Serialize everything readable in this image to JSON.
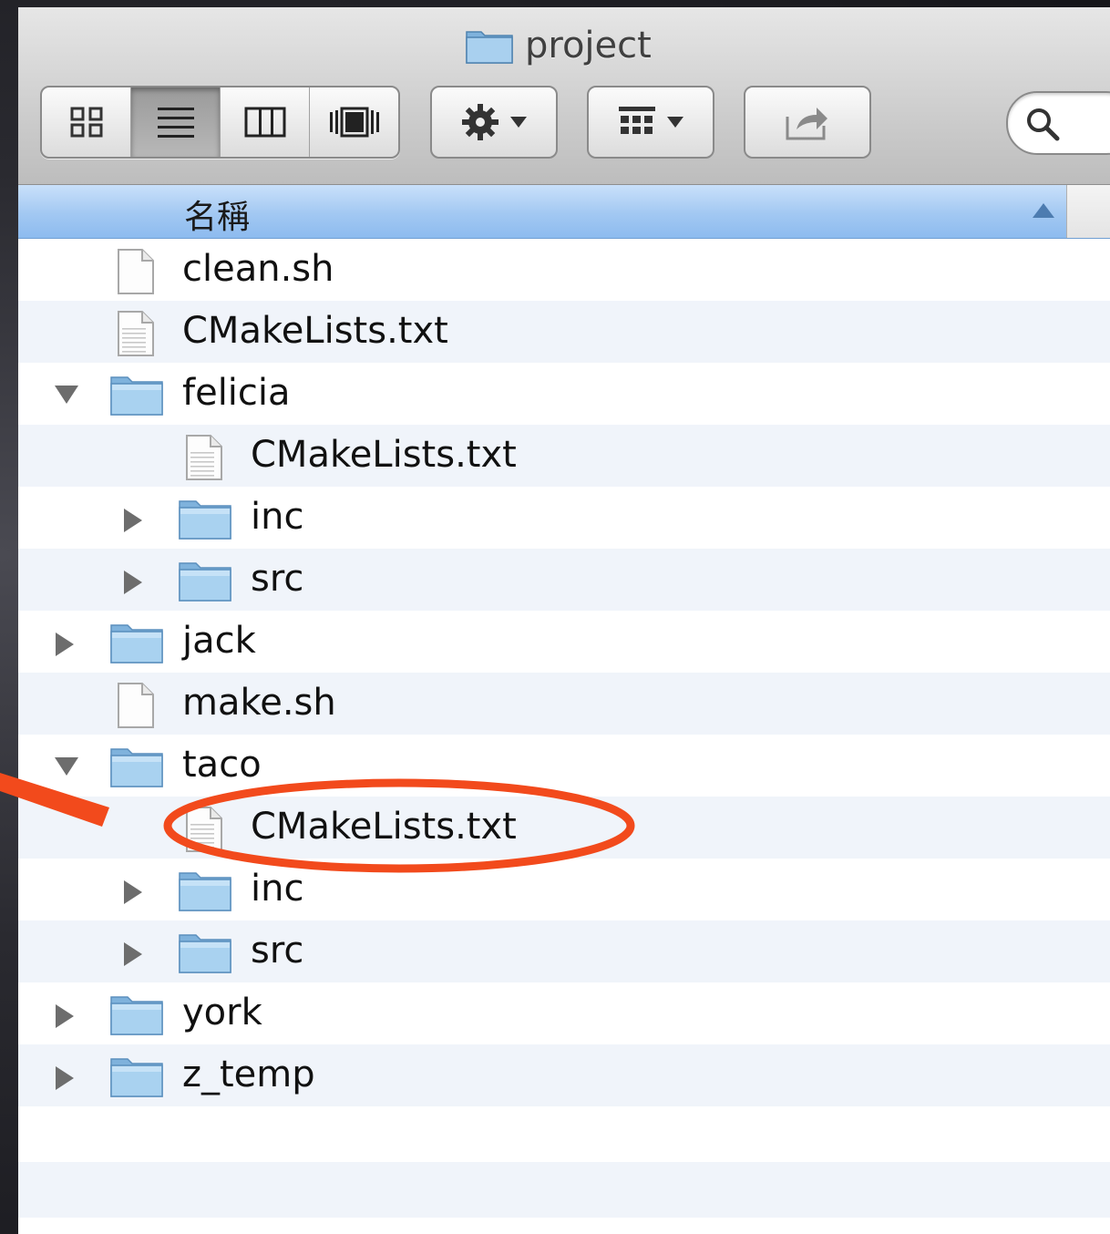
{
  "window": {
    "title": "project"
  },
  "toolbar": {
    "view_modes": [
      {
        "name": "icon-view",
        "icon": "grid-icon",
        "active": false
      },
      {
        "name": "list-view",
        "icon": "list-icon",
        "active": true
      },
      {
        "name": "column-view",
        "icon": "columns-icon",
        "active": false
      },
      {
        "name": "coverflow-view",
        "icon": "coverflow-icon",
        "active": false
      }
    ],
    "action_icon": "gear-icon",
    "arrange_icon": "arrange-icon",
    "share_icon": "share-icon",
    "search_icon": "search-icon"
  },
  "columns": {
    "name": "名稱"
  },
  "files": [
    {
      "name": "clean.sh",
      "type": "file",
      "level": 0
    },
    {
      "name": "CMakeLists.txt",
      "type": "text",
      "level": 0
    },
    {
      "name": "felicia",
      "type": "folder",
      "level": 0,
      "expanded": true
    },
    {
      "name": "CMakeLists.txt",
      "type": "text",
      "level": 1
    },
    {
      "name": "inc",
      "type": "folder",
      "level": 1,
      "expanded": false
    },
    {
      "name": "src",
      "type": "folder",
      "level": 1,
      "expanded": false
    },
    {
      "name": "jack",
      "type": "folder",
      "level": 0,
      "expanded": false
    },
    {
      "name": "make.sh",
      "type": "file",
      "level": 0
    },
    {
      "name": "taco",
      "type": "folder",
      "level": 0,
      "expanded": true
    },
    {
      "name": "CMakeLists.txt",
      "type": "text",
      "level": 1,
      "highlighted": true
    },
    {
      "name": "inc",
      "type": "folder",
      "level": 1,
      "expanded": false
    },
    {
      "name": "src",
      "type": "folder",
      "level": 1,
      "expanded": false
    },
    {
      "name": "york",
      "type": "folder",
      "level": 0,
      "expanded": false
    },
    {
      "name": "z_temp",
      "type": "folder",
      "level": 0,
      "expanded": false
    }
  ],
  "colors": {
    "header": "#a2c8f2",
    "alt_row": "#f0f4fa",
    "folder": "#9ecbeb",
    "annotation": "#f24a1c"
  }
}
